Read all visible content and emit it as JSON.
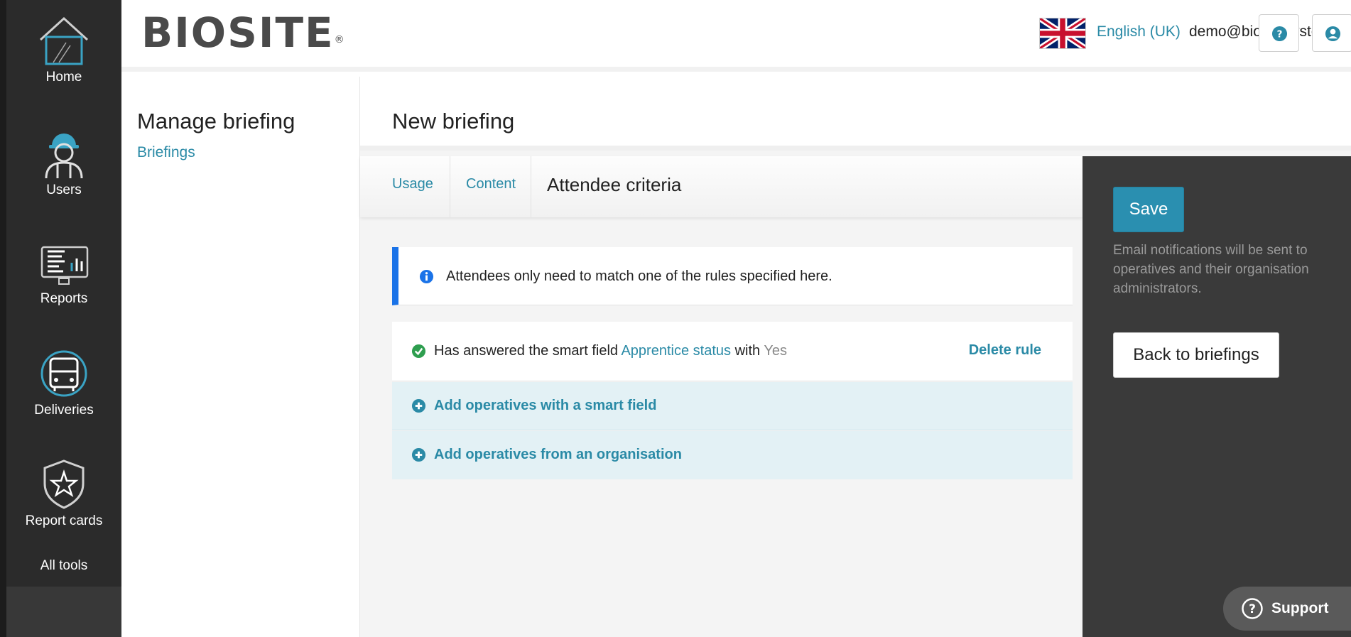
{
  "nav": {
    "items": [
      {
        "label": "Home",
        "icon": "house-icon"
      },
      {
        "label": "Users",
        "icon": "worker-icon"
      },
      {
        "label": "Reports",
        "icon": "report-icon"
      },
      {
        "label": "Deliveries",
        "icon": "truck-icon"
      },
      {
        "label": "Report cards",
        "icon": "shield-star-icon"
      }
    ],
    "all_tools": "All tools"
  },
  "header": {
    "logo_text": "BIOSITE",
    "logo_mark": "®",
    "language": "English (UK)",
    "email": "demo@biositesystems.com",
    "help_icon": "question-circle-icon",
    "account_icon": "user-circle-icon"
  },
  "subnav": {
    "title": "Manage briefing",
    "link": "Briefings"
  },
  "main": {
    "title": "New briefing",
    "tabs": [
      {
        "label": "Usage"
      },
      {
        "label": "Content"
      },
      {
        "label": "Attendee criteria",
        "active": true
      }
    ],
    "info": "Attendees only need to match one of the rules specified here.",
    "rule": {
      "prefix": "Has answered the smart field",
      "field": "Apprentice status",
      "middle": "with",
      "value": "Yes",
      "delete": "Delete rule"
    },
    "add_smart_field": "Add operatives with a smart field",
    "add_organisation": "Add operatives from an organisation"
  },
  "side": {
    "save": "Save",
    "note": "Email notifications will be sent to operatives and their organisation administrators.",
    "back": "Back to briefings"
  },
  "support": {
    "label": "Support"
  },
  "colors": {
    "accent": "#2a8aa6",
    "info_border": "#1a73e8",
    "check_green": "#2e9e4f",
    "rail": "#2b2b2b",
    "side_panel": "#3a3a3a"
  }
}
